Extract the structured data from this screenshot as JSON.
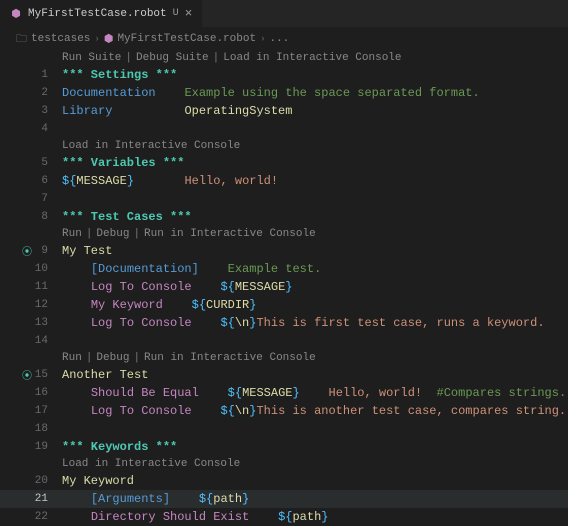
{
  "tab": {
    "filename": "MyFirstTestCase.robot",
    "modified_indicator": "U"
  },
  "breadcrumb": {
    "segments": [
      "testcases",
      "MyFirstTestCase.robot",
      "..."
    ]
  },
  "suite_codelens": {
    "items": [
      "Run Suite",
      "Debug Suite",
      "Load in Interactive Console"
    ]
  },
  "codelens": {
    "load": "Load in Interactive Console",
    "run_debug_run": [
      "Run",
      "Debug",
      "Run in Interactive Console"
    ]
  },
  "sections": {
    "settings": "*** Settings ***",
    "variables": "*** Variables ***",
    "testcases": "*** Test Cases ***",
    "keywords": "*** Keywords ***"
  },
  "settings": {
    "documentation_key": "Documentation",
    "documentation_val": "Example using the space separated format.",
    "library_key": "Library",
    "library_val": "OperatingSystem"
  },
  "variables": {
    "message_name": "MESSAGE",
    "message_val": "Hello, world!"
  },
  "tests": {
    "my_test": {
      "name": "My Test",
      "doc_key": "Documentation",
      "doc_val": "Example test.",
      "log1": "Log To Console",
      "log1_arg": "MESSAGE",
      "mykw": "My Keyword",
      "mykw_arg": "CURDIR",
      "log2": "Log To Console",
      "log2_escape": "\\n",
      "log2_text": "This is first test case, runs a keyword."
    },
    "another_test": {
      "name": "Another Test",
      "sbe": "Should Be Equal",
      "sbe_arg": "MESSAGE",
      "sbe_expected": "Hello, world!",
      "sbe_comment": "#Compares strings.",
      "log": "Log To Console",
      "log_escape": "\\n",
      "log_text": "This is another test case, compares string."
    }
  },
  "keywords": {
    "my_keyword": {
      "name": "My Keyword",
      "args_key": "Arguments",
      "args_var": "path",
      "dse": "Directory Should Exist",
      "dse_arg": "path"
    }
  }
}
